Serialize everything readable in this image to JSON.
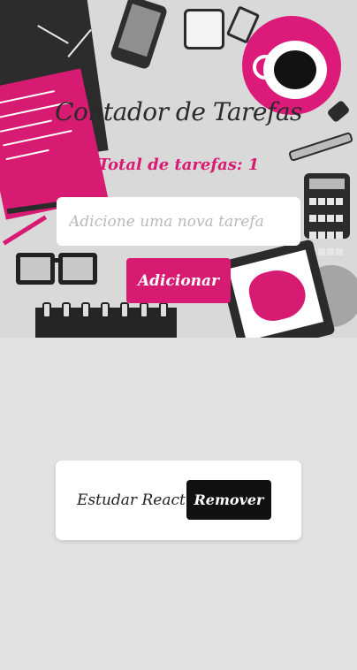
{
  "app": {
    "title": "Contador de Tarefas",
    "task_count_label": "Total de tarefas: 1"
  },
  "form": {
    "input_placeholder": "Adicione uma nova tarefa",
    "input_value": "",
    "add_label": "Adicionar"
  },
  "tasks": [
    {
      "text": "Estudar React",
      "remove_label": "Remover"
    }
  ],
  "colors": {
    "accent": "#d81b72",
    "dark": "#111111",
    "background": "#e2e2e2"
  }
}
